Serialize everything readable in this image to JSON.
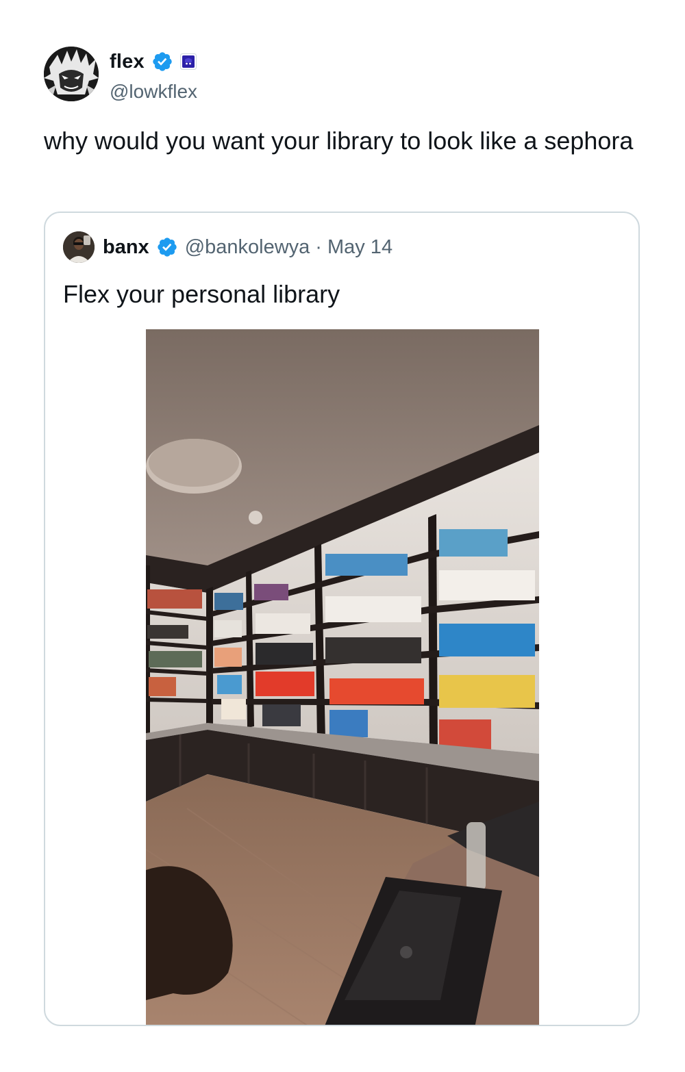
{
  "tweet": {
    "author": {
      "name": "flex",
      "handle": "@lowkflex",
      "avatar_icon": "anime-character-avatar",
      "verified_icon": "verified-badge-icon",
      "affiliate_icon": "affiliate-badge-icon"
    },
    "text": "why would you want your library to look like a sephora"
  },
  "quoted_tweet": {
    "author": {
      "name": "banx",
      "handle": "@bankolewya",
      "avatar_icon": "user-avatar",
      "verified_icon": "verified-badge-icon"
    },
    "separator": "·",
    "date": "May 14",
    "text": "Flex your personal library",
    "media": {
      "type": "photo",
      "subject": "bookshelf-room-photo"
    }
  },
  "colors": {
    "text_primary": "#0f1419",
    "text_secondary": "#536471",
    "border": "#cfd9de",
    "verified_blue": "#1d9bf0",
    "affiliate_purple": "#3b2fb0"
  }
}
